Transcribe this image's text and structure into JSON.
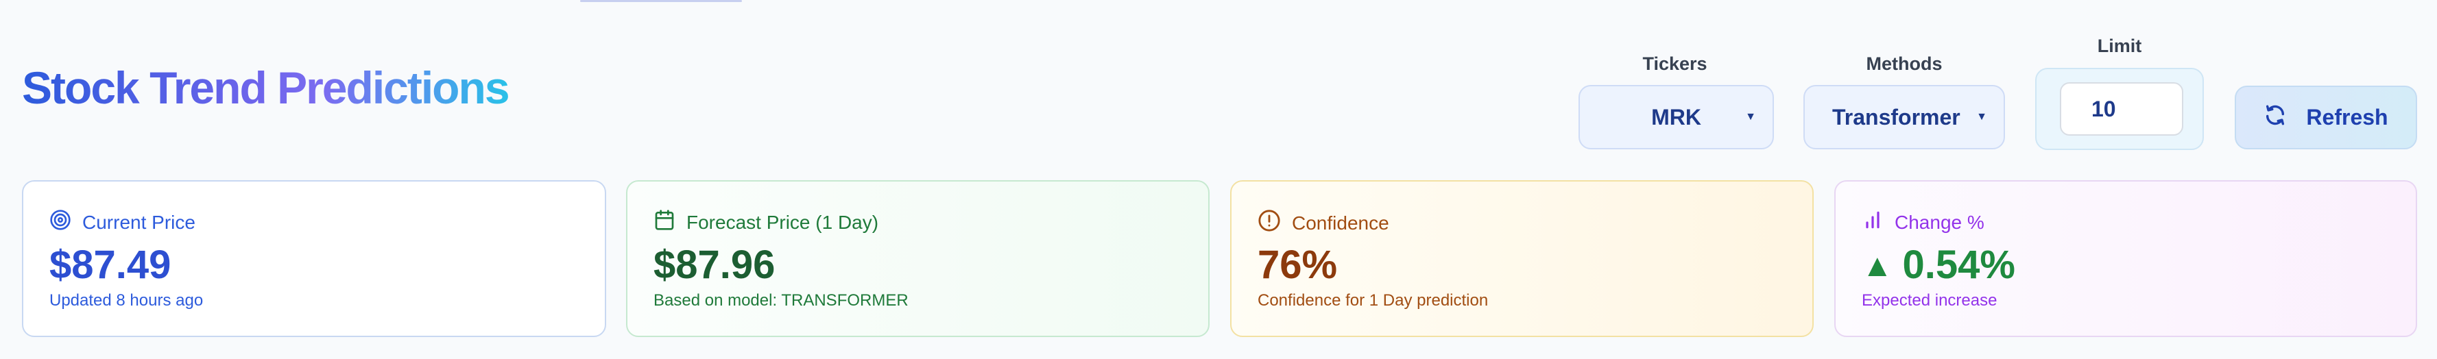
{
  "header": {
    "title": "Stock Trend Predictions"
  },
  "controls": {
    "tickers": {
      "label": "Tickers",
      "selected": "MRK"
    },
    "methods": {
      "label": "Methods",
      "selected": "Transformer"
    },
    "limit": {
      "label": "Limit",
      "value": "10"
    },
    "refresh_label": "Refresh"
  },
  "cards": [
    {
      "title": "Current Price",
      "value": "$87.49",
      "sub": "Updated 8 hours ago",
      "icon": "target-icon"
    },
    {
      "title": "Forecast Price (1 Day)",
      "value": "$87.96",
      "sub": "Based on model: TRANSFORMER",
      "icon": "calendar-icon"
    },
    {
      "title": "Confidence",
      "value": "76%",
      "sub": "Confidence for 1 Day prediction",
      "icon": "alert-circle-icon"
    },
    {
      "title": "Change %",
      "value": "0.54%",
      "sub": "Expected increase",
      "icon": "bar-chart-icon",
      "trend": "up"
    }
  ],
  "colors": {
    "primary": "#2d5bdc",
    "green": "#1f8a3f",
    "amber": "#a14d12",
    "purple": "#9333ea"
  }
}
